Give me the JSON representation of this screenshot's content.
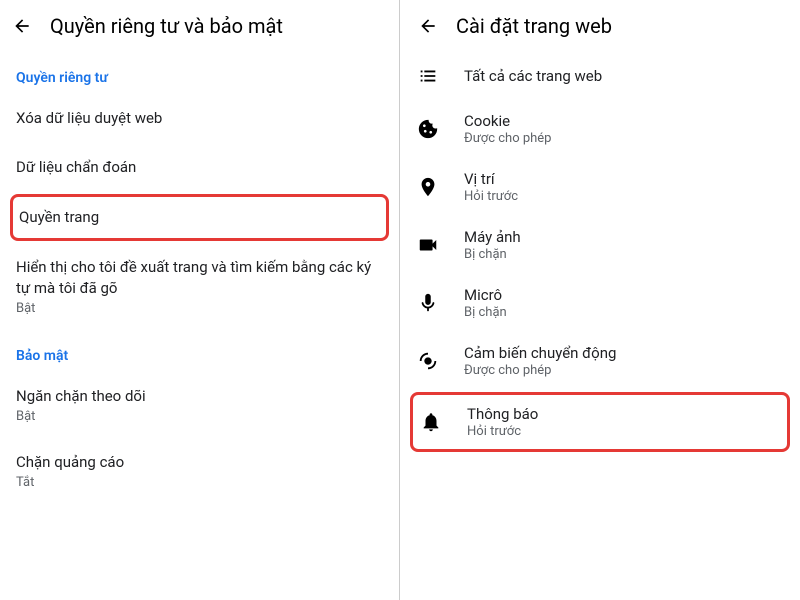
{
  "left": {
    "title": "Quyền riêng tư và bảo mật",
    "section1": "Quyền riêng tư",
    "items": {
      "clear_data": "Xóa dữ liệu duyệt web",
      "diagnostics": "Dữ liệu chẩn đoán",
      "site_permissions": "Quyền trang",
      "suggestions": "Hiển thị cho tôi đề xuất trang và tìm kiếm bằng các ký tự mà tôi đã gõ",
      "suggestions_status": "Bật"
    },
    "section2": "Bảo mật",
    "items2": {
      "tracking": "Ngăn chặn theo dõi",
      "tracking_status": "Bật",
      "adblock": "Chặn quảng cáo",
      "adblock_status": "Tắt"
    }
  },
  "right": {
    "title": "Cài đặt trang web",
    "items": {
      "all_sites": {
        "label": "Tất cả các trang web"
      },
      "cookie": {
        "label": "Cookie",
        "status": "Được cho phép"
      },
      "location": {
        "label": "Vị trí",
        "status": "Hỏi trước"
      },
      "camera": {
        "label": "Máy ảnh",
        "status": "Bị chặn"
      },
      "mic": {
        "label": "Micrô",
        "status": "Bị chặn"
      },
      "motion": {
        "label": "Cảm biến chuyển động",
        "status": "Được cho phép"
      },
      "notifications": {
        "label": "Thông báo",
        "status": "Hỏi trước"
      }
    }
  }
}
